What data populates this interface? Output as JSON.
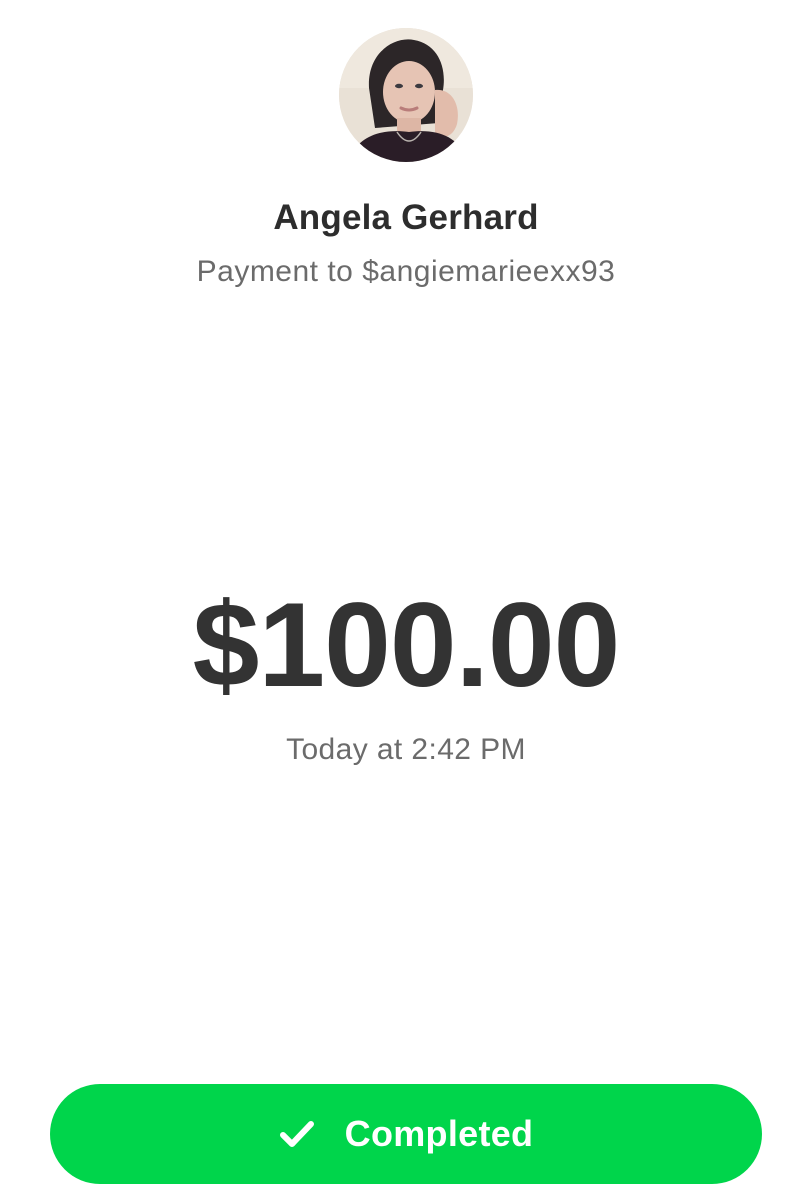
{
  "recipient": {
    "avatar_alt": "Angela Gerhard profile photo",
    "name": "Angela Gerhard",
    "subtitle": "Payment to $angiemarieexx93"
  },
  "payment": {
    "amount": "$100.00",
    "timestamp": "Today at 2:42 PM"
  },
  "status": {
    "label": "Completed",
    "icon": "check-icon",
    "color": "#00d54b"
  }
}
